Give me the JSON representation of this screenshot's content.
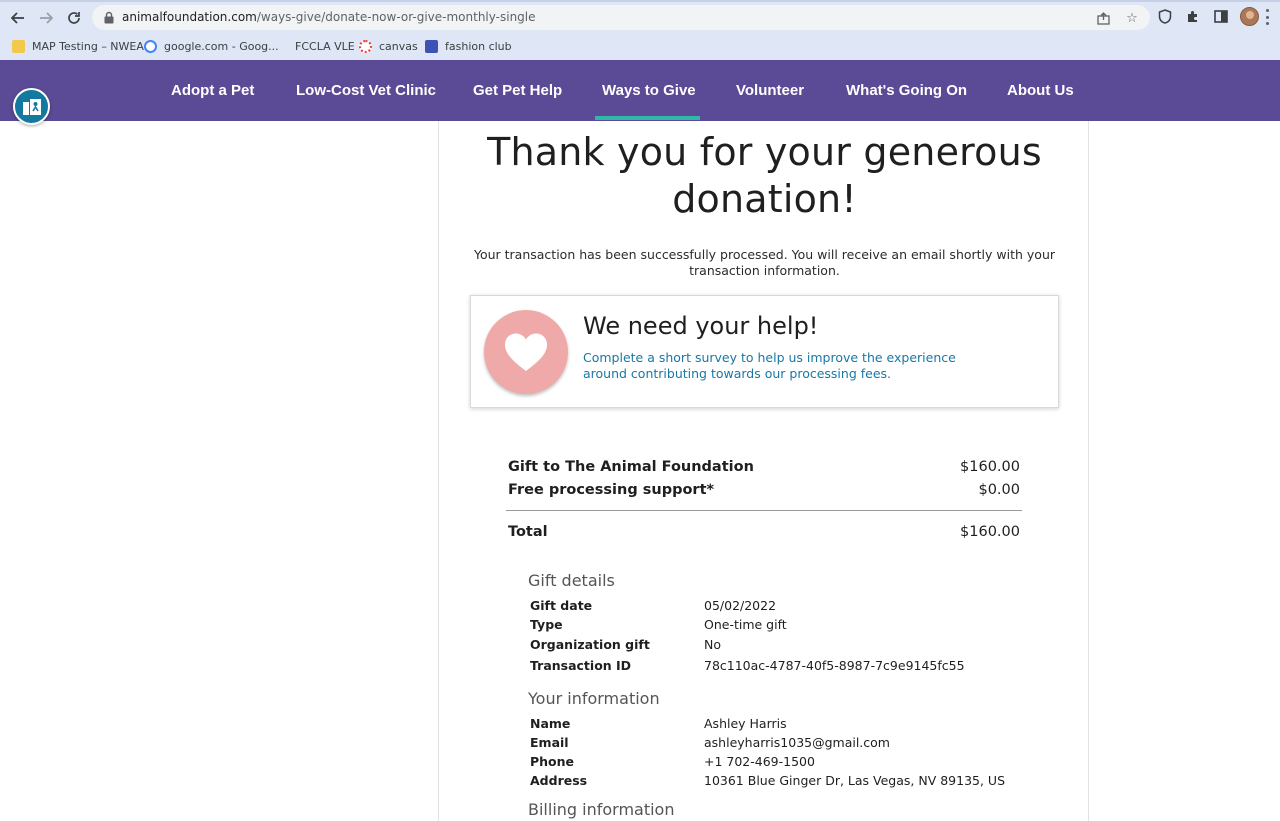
{
  "browser": {
    "url_host": "animalfoundation.com",
    "url_path": "/ways-give/donate-now-or-give-monthly-single",
    "bookmarks": [
      {
        "label": "MAP Testing – NWEA",
        "icon": "bookmark-yellow-icon",
        "color": "#f2c94c"
      },
      {
        "label": "google.com - Goog...",
        "icon": "google-icon",
        "color": "#4285f4"
      },
      {
        "label": "FCCLA VLE",
        "icon": "blank-icon",
        "color": "#dfe6f5"
      },
      {
        "label": "canvas",
        "icon": "canvas-icon",
        "color": "#e2443a"
      },
      {
        "label": "fashion club",
        "icon": "form-icon",
        "color": "#3f51b5"
      }
    ]
  },
  "site_nav": {
    "items": [
      {
        "label": "Adopt a Pet"
      },
      {
        "label": "Low-Cost Vet Clinic"
      },
      {
        "label": "Get Pet Help"
      },
      {
        "label": "Ways to Give"
      },
      {
        "label": "Volunteer"
      },
      {
        "label": "What's Going On"
      },
      {
        "label": "About Us"
      }
    ],
    "active": "Ways to Give",
    "bg_color": "#5b4a96",
    "accent_color": "#2fb8a8"
  },
  "confirmation": {
    "heading_line1": "Thank you for your generous",
    "heading_line2": "donation!",
    "message": "Your transaction has been successfully processed. You will receive an email shortly with your transaction information."
  },
  "help_card": {
    "title": "We need your help!",
    "link_text": "Complete a short survey to help us improve the experience around contributing towards our processing fees.",
    "icon": "heart-icon"
  },
  "summary": {
    "gift_label": "Gift to The Animal Foundation",
    "gift_amount": "$160.00",
    "processing_label": "Free processing support*",
    "processing_amount": "$0.00",
    "total_label": "Total",
    "total_amount": "$160.00"
  },
  "gift_details": {
    "title": "Gift details",
    "rows": [
      {
        "label": "Gift date",
        "value": "05/02/2022"
      },
      {
        "label": "Type",
        "value": "One-time gift"
      },
      {
        "label": "Organization gift",
        "value": "No"
      },
      {
        "label": "Transaction ID",
        "value": "78c110ac-4787-40f5-8987-7c9e9145fc55"
      }
    ]
  },
  "your_information": {
    "title": "Your information",
    "rows": [
      {
        "label": "Name",
        "value": "Ashley Harris"
      },
      {
        "label": "Email",
        "value": "ashleyharris1035@gmail.com"
      },
      {
        "label": "Phone",
        "value": "+1 702-469-1500"
      },
      {
        "label": "Address",
        "value": "10361 Blue Ginger Dr, Las Vegas, NV 89135, US"
      }
    ]
  },
  "billing_information": {
    "title": "Billing information"
  }
}
